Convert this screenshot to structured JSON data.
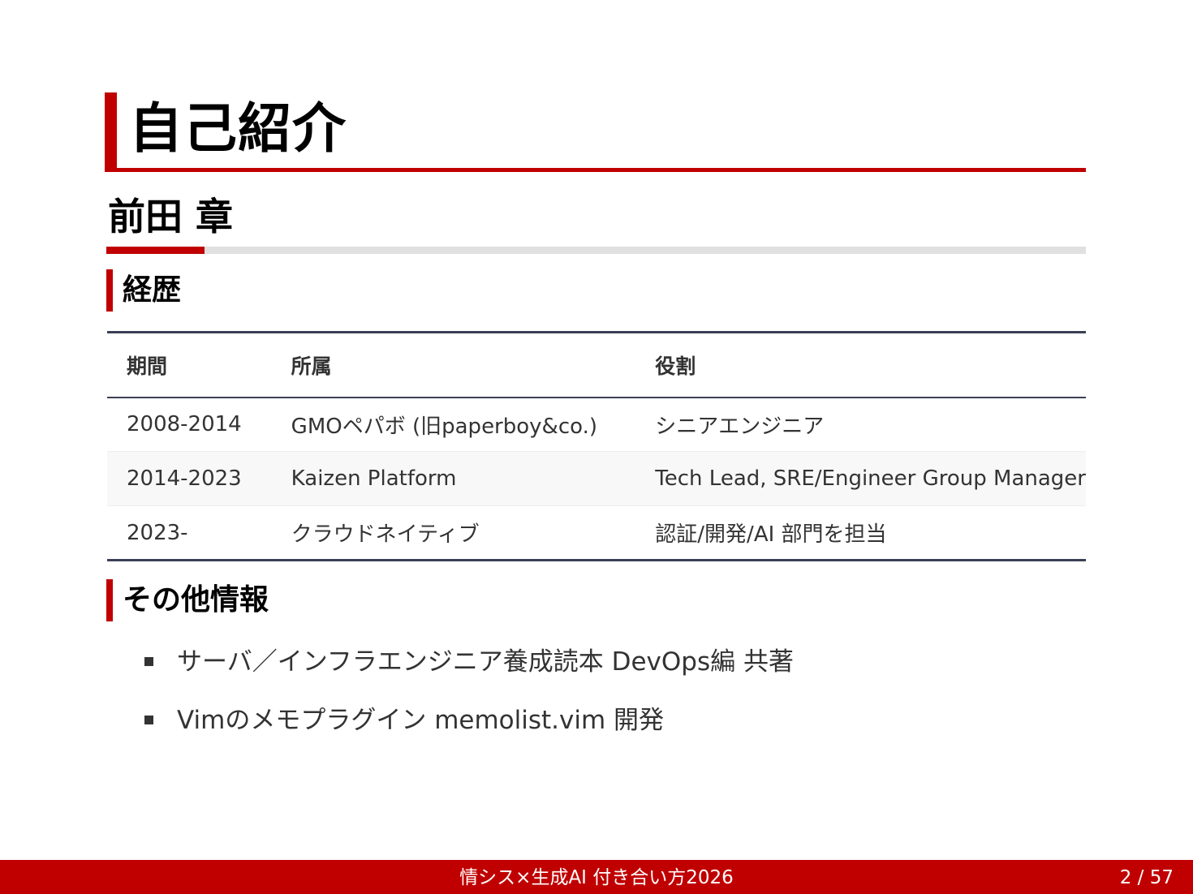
{
  "slide": {
    "title": "自己紹介",
    "name": "前田 章"
  },
  "career": {
    "heading": "経歴",
    "columns": [
      "期間",
      "所属",
      "役割"
    ],
    "rows": [
      [
        "2008-2014",
        "GMOペパボ (旧paperboy&co.)",
        "シニアエンジニア"
      ],
      [
        "2014-2023",
        "Kaizen Platform",
        "Tech Lead, SRE/Engineer Group Manager"
      ],
      [
        "2023-",
        "クラウドネイティブ",
        "認証/開発/AI 部門を担当"
      ]
    ]
  },
  "other": {
    "heading": "その他情報",
    "items": [
      "サーバ／インフラエンジニア養成読本 DevOps編 共著",
      "Vimのメモプラグイン memolist.vim 開発"
    ]
  },
  "footer": {
    "title": "情シス×生成AI 付き合い方2026",
    "page": "2 / 57"
  },
  "colors": {
    "accent": "#c00000",
    "table_border": "#3a3f55",
    "text": "#333333"
  }
}
